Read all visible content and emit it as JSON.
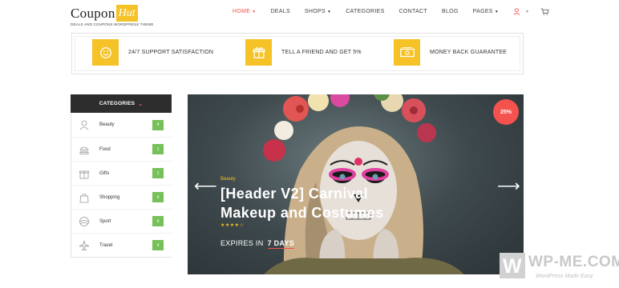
{
  "brand": {
    "name": "Coupon",
    "badge": "Hut",
    "tagline": "DEALS AND COUPONS WORDPRESS THEME",
    "accent": "#f5c228",
    "highlight": "#f4524d"
  },
  "nav": {
    "home": "HOME",
    "deals": "DEALS",
    "shops": "SHOPS",
    "categories": "CATEGORIES",
    "contact": "CONTACT",
    "blog": "BLOG",
    "pages": "PAGES",
    "active": "home"
  },
  "features": [
    {
      "icon": "support-icon",
      "label": "24/7 SUPPORT SATISFACTION"
    },
    {
      "icon": "gift-icon",
      "label": "TELL A FRIEND AND GET 5%"
    },
    {
      "icon": "money-icon",
      "label": "MONEY BACK GUARANTEE"
    }
  ],
  "sidebar": {
    "header": "CATEGORIES",
    "items": [
      {
        "icon": "beauty-icon",
        "label": "Beauty",
        "count": "4"
      },
      {
        "icon": "food-icon",
        "label": "Food",
        "count": "1"
      },
      {
        "icon": "gift-icon",
        "label": "Gifts",
        "count": "1"
      },
      {
        "icon": "shopping-bag-icon",
        "label": "Shopping",
        "count": "0"
      },
      {
        "icon": "sport-ball-icon",
        "label": "Sport",
        "count": "0"
      },
      {
        "icon": "airplane-icon",
        "label": "Travel",
        "count": "4"
      }
    ],
    "count_color": "#77c159"
  },
  "hero": {
    "discount": "25%",
    "category": "Beauty",
    "title": "[Header V2] Carnival Makeup and Costumes",
    "rating": 4,
    "stars": "★★★★☆",
    "expires_label": "EXPIRES IN",
    "expires_value": "7 DAYS"
  },
  "watermark": {
    "letter": "W",
    "name": "WP-ME.COM",
    "tagline": "WordPress Made Easy"
  }
}
